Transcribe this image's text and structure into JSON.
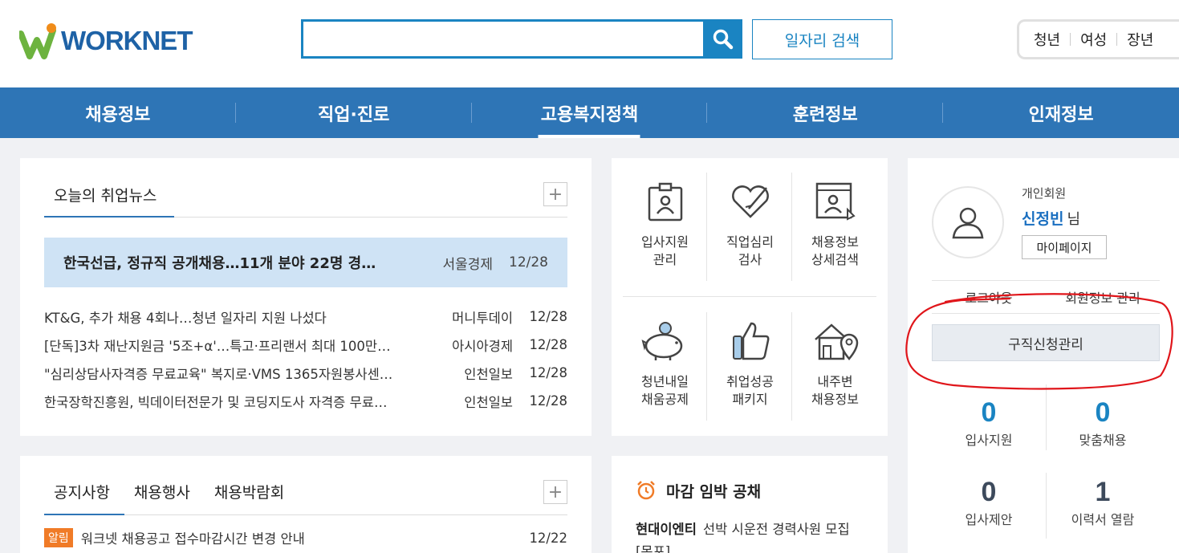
{
  "logo": {
    "text": "WORKNET"
  },
  "search": {
    "placeholder": "",
    "value": "",
    "job_search_label": "일자리 검색"
  },
  "targets": [
    "청년",
    "여성",
    "장년"
  ],
  "gnb": [
    {
      "label": "채용정보",
      "active": false
    },
    {
      "label": "직업·진로",
      "active": false
    },
    {
      "label": "고용복지정책",
      "active": true
    },
    {
      "label": "훈련정보",
      "active": false
    },
    {
      "label": "인재정보",
      "active": false
    }
  ],
  "news": {
    "tab_label": "오늘의 취업뉴스",
    "plus_label": "+",
    "headline": {
      "title": "한국선급, 정규직 공개채용…11개 분야 22명 경…",
      "source": "서울경제",
      "date": "12/28"
    },
    "items": [
      {
        "title": "KT&G, 추가 채용 4회나…청년 일자리 지원 나섰다",
        "source": "머니투데이",
        "date": "12/28"
      },
      {
        "title": "[단독]3차 재난지원금 '5조+α'…특고·프리랜서 최대 100만…",
        "source": "아시아경제",
        "date": "12/28"
      },
      {
        "title": "\"심리상담사자격증 무료교육\" 복지로·VMS 1365자원봉사센…",
        "source": "인천일보",
        "date": "12/28"
      },
      {
        "title": "한국장학진흥원, 빅데이터전문가 및 코딩지도사 자격증 무료…",
        "source": "인천일보",
        "date": "12/28"
      }
    ]
  },
  "services": [
    {
      "label": "입사지원\n관리",
      "icon": "id-card-icon"
    },
    {
      "label": "직업심리\n검사",
      "icon": "heart-pen-icon"
    },
    {
      "label": "채용정보\n상세검색",
      "icon": "document-person-icon"
    },
    {
      "label": "청년내일\n채움공제",
      "icon": "piggy-bank-icon"
    },
    {
      "label": "취업성공\n패키지",
      "icon": "thumbs-up-icon"
    },
    {
      "label": "내주변\n채용정보",
      "icon": "house-location-icon"
    }
  ],
  "user": {
    "member_type": "개인회원",
    "name": "신정빈",
    "suffix": "님",
    "mypage_label": "마이페이지",
    "logout_label": "로그아웃",
    "account_label": "회원정보 관리",
    "apply_label": "구직신청관리",
    "stats": [
      {
        "value": "0",
        "label": "입사지원",
        "color": "#1a84c2"
      },
      {
        "value": "0",
        "label": "맞춤채용",
        "color": "#1a84c2"
      },
      {
        "value": "0",
        "label": "입사제안",
        "color": "#3d4a5c"
      },
      {
        "value": "1",
        "label": "이력서 열람",
        "color": "#3d4a5c"
      }
    ]
  },
  "notice": {
    "tabs": [
      "공지사항",
      "채용행사",
      "채용박람회"
    ],
    "plus_label": "+",
    "item": {
      "badge": "알림",
      "title": "워크넷 채용공고 접수마감시간 변경 안내",
      "date": "12/22"
    }
  },
  "deadline": {
    "title": "마감 임박 공채",
    "company": "현대이엔티",
    "desc": "선박 시운전 경력사원 모집 [목포]"
  },
  "colors": {
    "primary": "#2e75b6",
    "accent": "#1a84c2",
    "highlight": "#cfe3f5",
    "annotation": "#e0151a"
  }
}
